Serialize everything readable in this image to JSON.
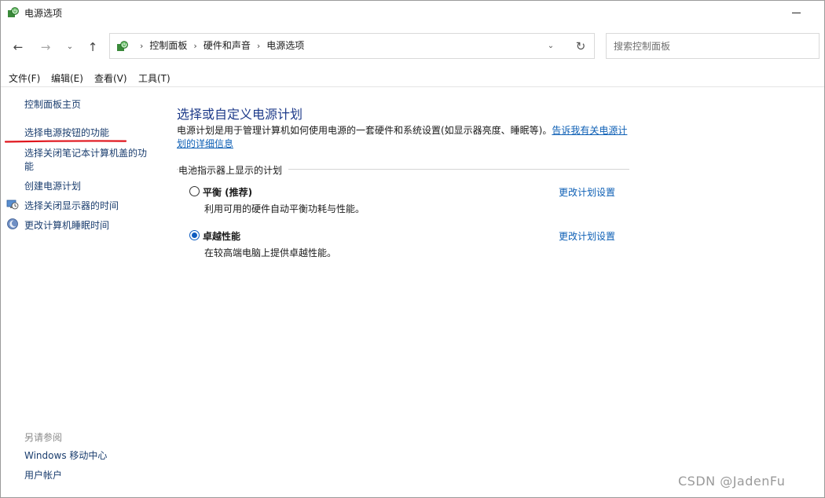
{
  "window": {
    "title": "电源选项",
    "app_icon": "power-options-icon"
  },
  "nav": {
    "back_icon": "back-arrow-icon",
    "forward_icon": "forward-arrow-icon",
    "recent_icon": "chevron-down-icon",
    "up_icon": "up-arrow-icon",
    "breadcrumbs": [
      "控制面板",
      "硬件和声音",
      "电源选项"
    ],
    "search_placeholder": "搜索控制面板"
  },
  "menu": [
    "文件(F)",
    "编辑(E)",
    "查看(V)",
    "工具(T)"
  ],
  "sidebar": {
    "links": [
      "控制面板主页",
      "选择电源按钮的功能",
      "选择关闭笔记本计算机盖的功能",
      "创建电源计划",
      "选择关闭显示器的时间",
      "更改计算机睡眠时间"
    ],
    "see_also_title": "另请参阅",
    "see_also": [
      "Windows 移动中心",
      "用户帐户"
    ],
    "highlight_color": "#e0151c"
  },
  "main": {
    "heading": "选择或自定义电源计划",
    "description": "电源计划是用于管理计算机如何使用电源的一套硬件和系统设置(如显示器亮度、睡眠等)。",
    "description_link": "告诉我有关电源计划的详细信息",
    "group_label": "电池指示器上显示的计划",
    "plans": [
      {
        "name": "平衡 (推荐)",
        "description": "利用可用的硬件自动平衡功耗与性能。",
        "change_link": "更改计划设置",
        "selected": false
      },
      {
        "name": "卓越性能",
        "description": "在较高端电脑上提供卓越性能。",
        "change_link": "更改计划设置",
        "selected": true
      }
    ]
  },
  "watermark": "CSDN @JadenFu",
  "colors": {
    "heading": "#1e3b8a",
    "link": "#0d5fb5",
    "radio_checked": "#0f5cc0"
  }
}
